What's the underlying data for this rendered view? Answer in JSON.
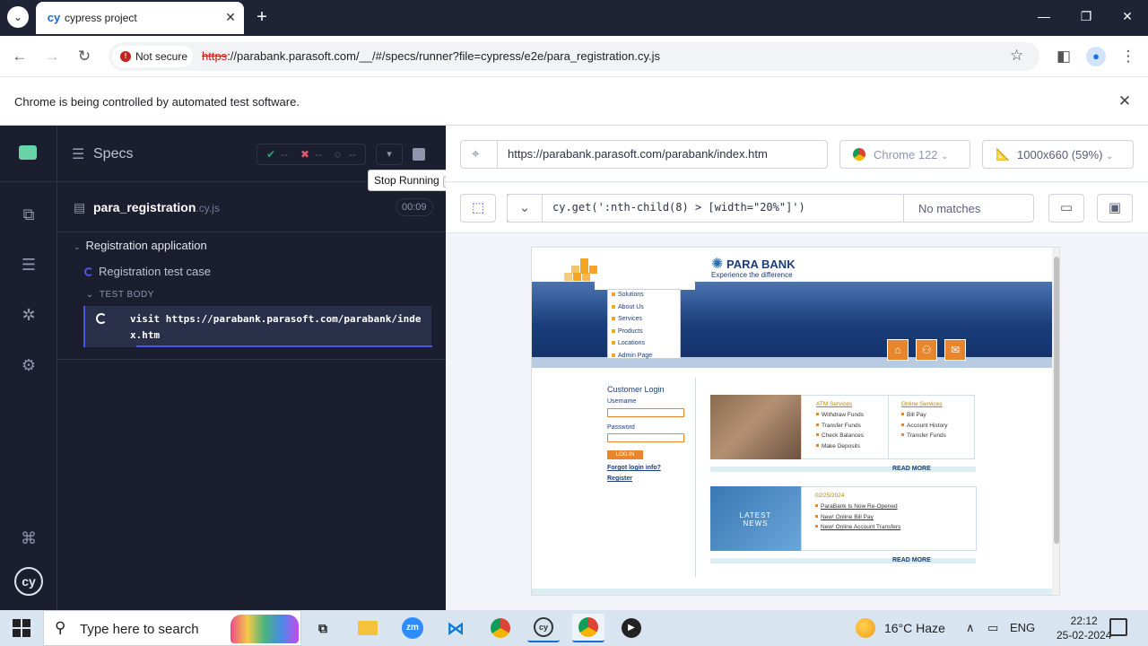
{
  "browser": {
    "tab_title": "cypress project",
    "url_scheme": "https",
    "url_rest": "://parabank.parasoft.com/__/#/specs/runner?file=cypress/e2e/para_registration.cy.js",
    "not_secure": "Not secure",
    "infobar": "Chrome is being controlled by automated test software."
  },
  "reporter": {
    "specs_label": "Specs",
    "passed": "--",
    "failed": "--",
    "pending": "--",
    "tooltip": "Stop Running",
    "tooltip_key": "S",
    "spec_name": "para_registration",
    "spec_ext": ".cy.js",
    "duration": "00:09",
    "suite": "Registration application",
    "test": "Registration test case",
    "body_label": "TEST BODY",
    "command": "visit  https://parabank.parasoft.com/parabank/index.htm"
  },
  "aut": {
    "url": "https://parabank.parasoft.com/parabank/index.htm",
    "browser": "Chrome 122",
    "viewport": "1000x660 (59%)",
    "selector": "cy.get(':nth-child(8) > [width=\"20%\"]')",
    "matches": "No matches"
  },
  "parabank": {
    "brand": "PARA BANK",
    "tagline": "Experience the difference",
    "menu": [
      "Solutions",
      "About Us",
      "Services",
      "Products",
      "Locations",
      "Admin Page"
    ],
    "login_title": "Customer Login",
    "username_label": "Username",
    "password_label": "Password",
    "login_button": "LOG IN",
    "forgot": "Forgot login info?",
    "register": "Register",
    "atm_title": "ATM Services",
    "atm_items": [
      "Withdraw Funds",
      "Transfer Funds",
      "Check Balances",
      "Make Deposits"
    ],
    "online_title": "Online Services",
    "online_items": [
      "Bill Pay",
      "Account History",
      "Transfer Funds"
    ],
    "read_more": "READ MORE",
    "news_label_1": "LATEST",
    "news_label_2": "NEWS",
    "news_date": "02/25/2024",
    "news_items": [
      "ParaBank Is Now Re-Opened",
      "New! Online Bill Pay",
      "New! Online Account Transfers"
    ]
  },
  "taskbar": {
    "search_placeholder": "Type here to search",
    "weather": "16°C  Haze",
    "language": "ENG",
    "time": "22:12",
    "date": "25-02-2024"
  }
}
